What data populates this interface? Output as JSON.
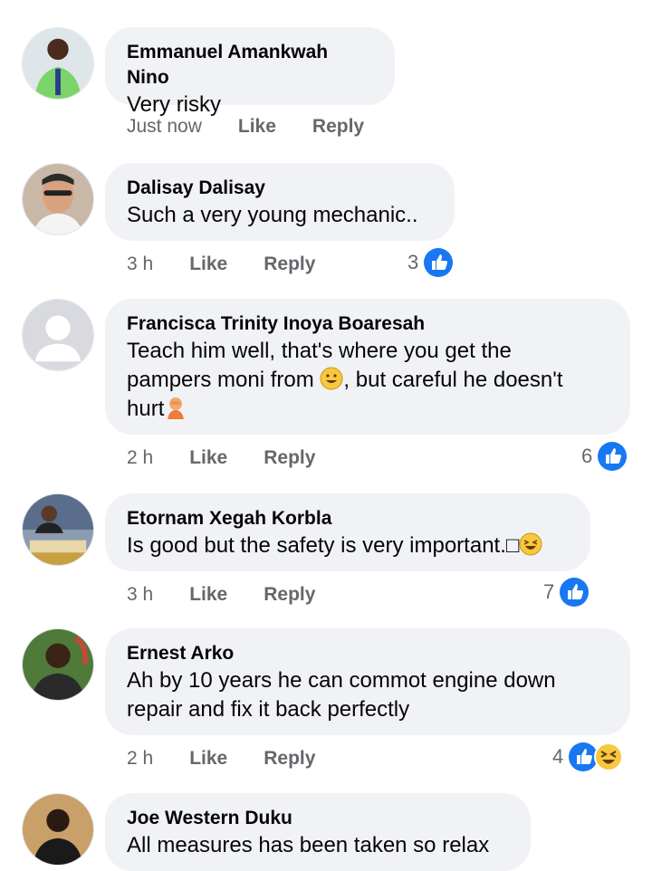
{
  "comments": [
    {
      "author": "Emmanuel Amankwah Nino",
      "text": "Very risky",
      "time": "Just now",
      "like": "Like",
      "reply": "Reply",
      "reaction_count": ""
    },
    {
      "author": "Dalisay Dalisay",
      "text": "Such a very young mechanic..",
      "time": "3 h",
      "like": "Like",
      "reply": "Reply",
      "reaction_count": "3"
    },
    {
      "author": "Francisca Trinity Inoya Boaresah",
      "text_line1": "Teach him well, that's where you get the",
      "text_line2a": "pampers moni from ",
      "text_line2b": ", but careful he doesn't",
      "text_line3": "hurt",
      "time": "2 h",
      "like": "Like",
      "reply": "Reply",
      "reaction_count": "6"
    },
    {
      "author": "Etornam Xegah Korbla",
      "text": "Is good but the safety is very important.□",
      "time": "3 h",
      "like": "Like",
      "reply": "Reply",
      "reaction_count": "7"
    },
    {
      "author": "Ernest Arko",
      "text_line1": "Ah by 10 years he can commot engine down",
      "text_line2": "repair and fix it back perfectly",
      "time": "2 h",
      "like": "Like",
      "reply": "Reply",
      "reaction_count": "4"
    },
    {
      "author": "Joe Western Duku",
      "text": "All measures has been taken so relax"
    }
  ],
  "colors": {
    "bubble": "#f0f2f5",
    "like_blue": "#1877f2",
    "meta_gray": "#65676b"
  },
  "icons": {
    "like": "thumbs-up-icon",
    "haha": "laughing-face-icon",
    "smile": "smiling-face-icon",
    "facepalm": "facepalm-icon"
  }
}
